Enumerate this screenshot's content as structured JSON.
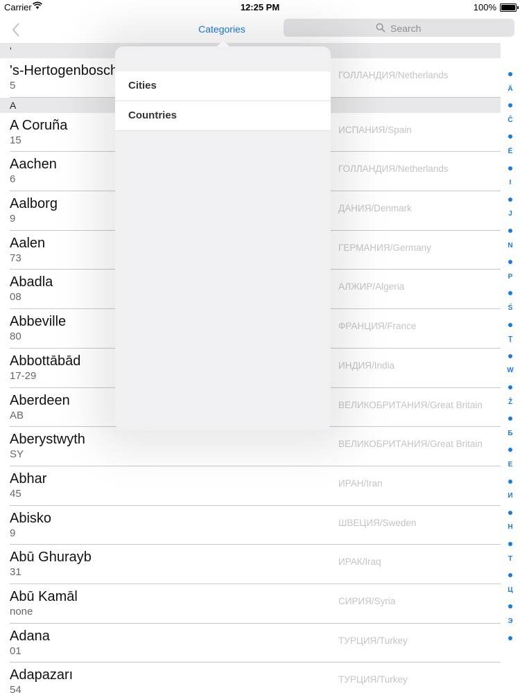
{
  "status_bar": {
    "carrier": "Carrier",
    "time": "12:25 PM",
    "battery": "100%"
  },
  "nav": {
    "title": "Categories",
    "back_icon": "chevron-left-icon"
  },
  "search": {
    "placeholder": "Search",
    "icon": "search-icon"
  },
  "list": {
    "sections": [
      {
        "header": "'",
        "rows": [
          {
            "name": "'s-Hertogenbosch",
            "code": "5",
            "country": "ГОЛЛАНДИЯ/Netherlands"
          }
        ]
      },
      {
        "header": "A",
        "rows": [
          {
            "name": "A Coruña",
            "code": "15",
            "country": "ИСПАНИЯ/Spain"
          },
          {
            "name": "Aachen",
            "code": "6",
            "country": "ГОЛЛАНДИЯ/Netherlands"
          },
          {
            "name": "Aalborg",
            "code": "9",
            "country": "ДАНИЯ/Denmark"
          },
          {
            "name": "Aalen",
            "code": "73",
            "country": "ГЕРМАНИЯ/Germany"
          },
          {
            "name": "Abadla",
            "code": "08",
            "country": "АЛЖИР/Algeria"
          },
          {
            "name": "Abbeville",
            "code": "80",
            "country": "ФРАНЦИЯ/France"
          },
          {
            "name": "Abbottābād",
            "code": "17-29",
            "country": "ИНДИЯ/India"
          },
          {
            "name": "Aberdeen",
            "code": "AB",
            "country": "ВЕЛИКОБРИТАНИЯ/Great Britain"
          },
          {
            "name": "Aberystwyth",
            "code": "SY",
            "country": "ВЕЛИКОБРИТАНИЯ/Great Britain"
          },
          {
            "name": "Abhar",
            "code": "45",
            "country": "ИРАН/Iran"
          },
          {
            "name": "Abisko",
            "code": "9",
            "country": "ШВЕЦИЯ/Sweden"
          },
          {
            "name": "Abū Ghurayb",
            "code": "31",
            "country": "ИРАК/Iraq"
          },
          {
            "name": "Abū Kamāl",
            "code": "none",
            "country": "СИРИЯ/Syria"
          },
          {
            "name": "Adana",
            "code": "01",
            "country": "ТУРЦИЯ/Turkey"
          },
          {
            "name": "Adapazarı",
            "code": "54",
            "country": "ТУРЦИЯ/Turkey"
          }
        ]
      }
    ]
  },
  "index": [
    "•",
    "Ä",
    "•",
    "Č",
    "•",
    "É",
    "•",
    "I",
    "•",
    "J",
    "•",
    "N",
    "•",
    "P",
    "•",
    "Ś",
    "•",
    "Ţ",
    "•",
    "W",
    "•",
    "Ž",
    "•",
    "Б",
    "•",
    "Е",
    "•",
    "И",
    "•",
    "Н",
    "•",
    "Т",
    "•",
    "Ц",
    "•",
    "Э",
    "•"
  ],
  "popover": {
    "items": [
      "Cities",
      "Countries"
    ]
  }
}
